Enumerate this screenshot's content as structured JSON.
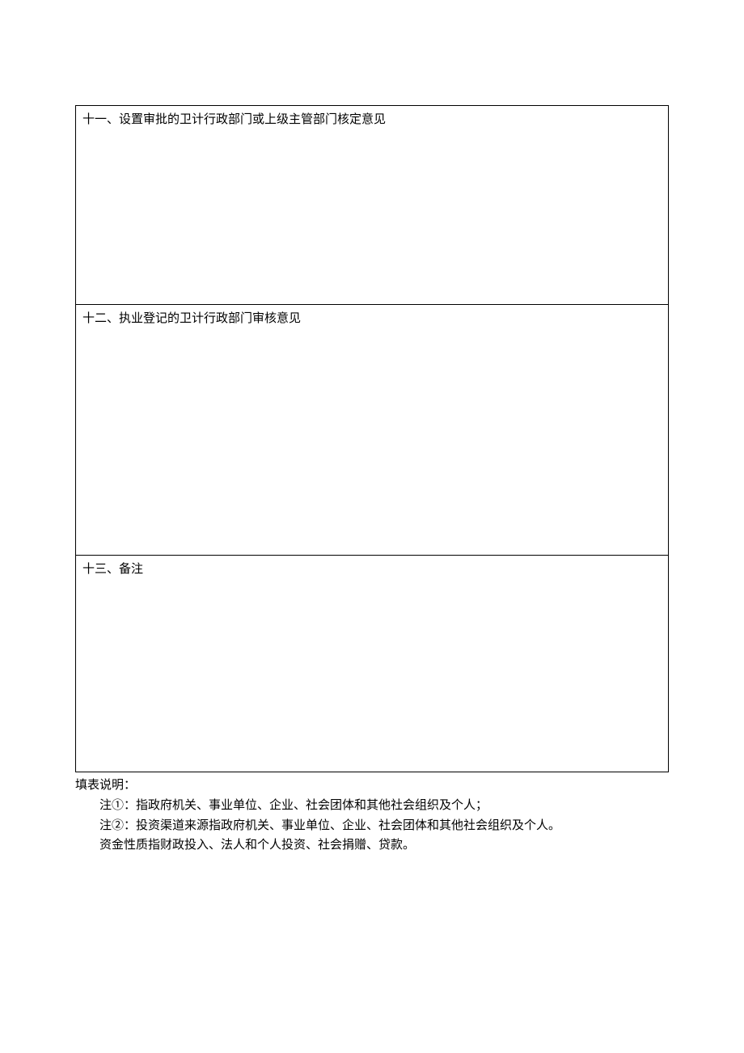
{
  "table": {
    "row11": "十一、设置审批的卫计行政部门或上级主管部门核定意见",
    "row12": "十二、执业登记的卫计行政部门审核意见",
    "row13": "十三、备注"
  },
  "notes": {
    "heading": "填表说明：",
    "line1": "注①：指政府机关、事业单位、企业、社会团体和其他社会组织及个人；",
    "line2": "注②：投资渠道来源指政府机关、事业单位、企业、社会团体和其他社会组织及个人。",
    "line3": "资金性质指财政投入、法人和个人投资、社会捐赠、贷款。"
  }
}
